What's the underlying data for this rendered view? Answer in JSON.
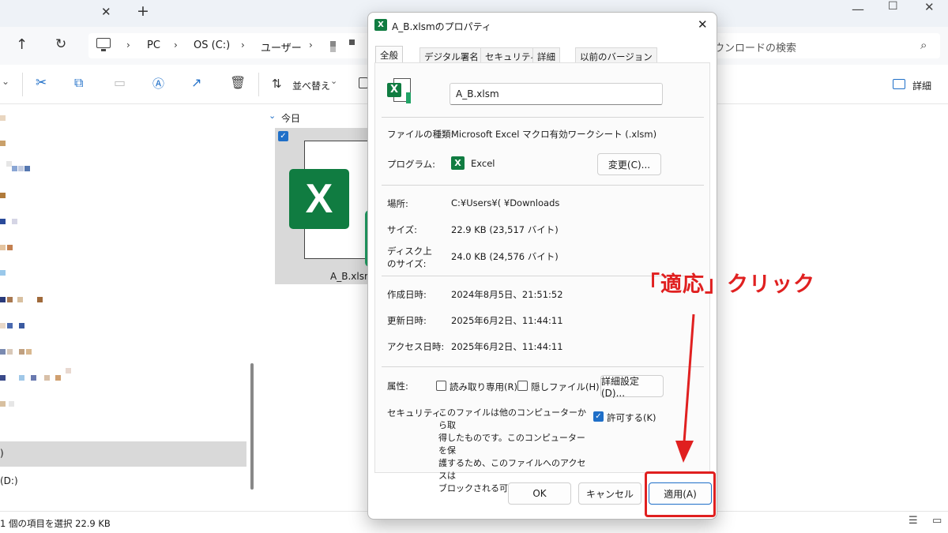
{
  "explorer": {
    "breadcrumb": [
      "PC",
      "OS (C:)",
      "ユーザー"
    ],
    "search_placeholder": "ウンロードの検索",
    "sort_label": "並べ替え",
    "details_label": "詳細",
    "group_label": "今日",
    "file_name": "A_B.xlsm",
    "sidebar_drive_c": ")",
    "sidebar_drive_d": "(D:)",
    "status_text": "1 個の項目を選択  22.9 KB"
  },
  "dialog": {
    "title": "A_B.xlsmのプロパティ",
    "tabs": [
      "全般",
      "デジタル署名",
      "セキュリティ",
      "詳細",
      "以前のバージョン"
    ],
    "filename_value": "A_B.xlsm",
    "type_label": "ファイルの種類:",
    "type_value": "Microsoft Excel マクロ有効ワークシート (.xlsm)",
    "program_label": "プログラム:",
    "program_value": "Excel",
    "change_button": "変更(C)...",
    "location_label": "場所:",
    "location_value": "C:¥Users¥(   ¥Downloads",
    "size_label": "サイズ:",
    "size_value": "22.9 KB (23,517 バイト)",
    "disk_size_label_1": "ディスク上",
    "disk_size_label_2": "のサイズ:",
    "disk_size_value": "24.0 KB (24,576 バイト)",
    "created_label": "作成日時:",
    "created_value": "2024年8月5日、21:51:52",
    "modified_label": "更新日時:",
    "modified_value": "2025年6月2日、11:44:11",
    "accessed_label": "アクセス日時:",
    "accessed_value": "2025年6月2日、11:44:11",
    "attributes_label": "属性:",
    "readonly_label": "読み取り専用(R)",
    "hidden_label": "隠しファイル(H)",
    "advanced_button": "詳細設定(D)...",
    "security_label": "セキュリティ:",
    "security_text": [
      "このファイルは他のコンピューターから取",
      "得したものです。このコンピューターを保",
      "護するため、このファイルへのアクセスは",
      "ブロックされる可能性があります。"
    ],
    "unblock_label": "許可する(K)",
    "unblock_checked": true,
    "ok_button": "OK",
    "cancel_button": "キャンセル",
    "apply_button": "適用(A)"
  },
  "annotation": {
    "text": "「適応」クリック",
    "color": "#e02020"
  },
  "colors": {
    "excel_green": "#107c41",
    "checkbox_blue": "#1f6fc8",
    "selection_gray": "#d9d9d9"
  }
}
